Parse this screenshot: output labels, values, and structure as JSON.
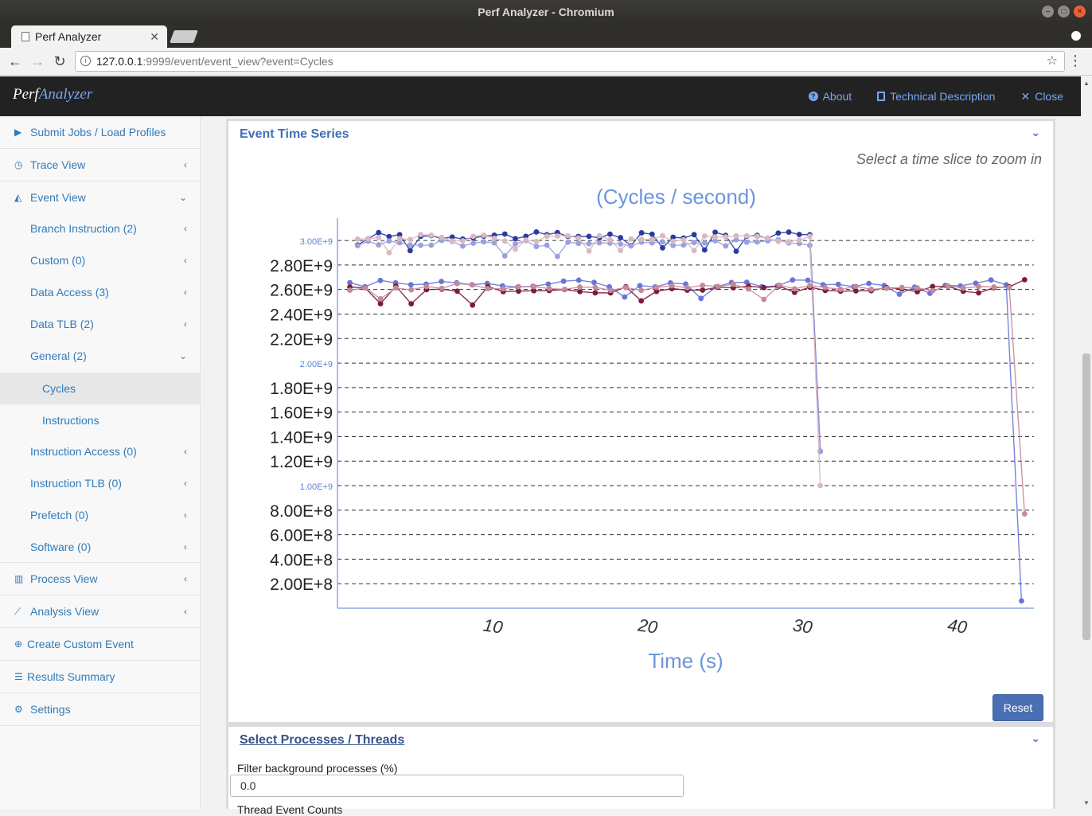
{
  "window": {
    "title": "Perf Analyzer - Chromium"
  },
  "browser": {
    "tab_title": "Perf Analyzer",
    "url_host": "127.0.0.1",
    "url_rest": ":9999/event/event_view?event=Cycles"
  },
  "header": {
    "brand_part1": "Perf",
    "brand_part2": "Analyzer",
    "links": {
      "about": "About",
      "technical": "Technical Description",
      "close": "Close"
    }
  },
  "sidebar": {
    "items": {
      "submit": "Submit Jobs / Load Profiles",
      "trace": "Trace View",
      "event": "Event View",
      "branch": "Branch Instruction (2)",
      "custom": "Custom (0)",
      "data_access": "Data Access (3)",
      "data_tlb": "Data TLB (2)",
      "general": "General (2)",
      "cycles": "Cycles",
      "instructions": "Instructions",
      "instr_access": "Instruction Access (0)",
      "instr_tlb": "Instruction TLB (0)",
      "prefetch": "Prefetch (0)",
      "software": "Software (0)",
      "process": "Process View",
      "analysis": "Analysis View",
      "create_custom": "Create Custom Event",
      "results": "Results Summary",
      "settings": "Settings"
    }
  },
  "event_panel": {
    "title": "Event Time Series",
    "hint": "Select a time slice to zoom in",
    "reset": "Reset"
  },
  "chart_data": {
    "type": "line",
    "title": "(Cycles / second)",
    "xlabel": "Time (s)",
    "ylabel": "",
    "xlim": [
      0,
      45
    ],
    "ylim": [
      0,
      3150000000
    ],
    "x_ticks": [
      "10",
      "20",
      "30",
      "40"
    ],
    "y_ticks_large": [
      "2.80E+9",
      "2.60E+9",
      "2.40E+9",
      "2.20E+9",
      "1.80E+9",
      "1.60E+9",
      "1.40E+9",
      "1.20E+9",
      "8.00E+8",
      "6.00E+8",
      "4.00E+8",
      "2.00E+8"
    ],
    "y_ticks_small": [
      "3.00E+9",
      "2.00E+9",
      "1.00E+9"
    ],
    "grid": true,
    "series": [
      {
        "color": "#2b3a9e",
        "start": 1.3,
        "end": 31.2,
        "level": 3040000000,
        "end_value": 1280000000
      },
      {
        "color": "#9aa0e0",
        "start": 1.3,
        "end": 31.2,
        "level": 2980000000,
        "end_value": 1280000000
      },
      {
        "color": "#d9b9c0",
        "start": 1.3,
        "end": 31.2,
        "level": 3020000000,
        "end_value": 1000000000
      },
      {
        "color": "#6a75d8",
        "start": 0.8,
        "end": 44.2,
        "level": 2650000000,
        "end_value": 60000000
      },
      {
        "color": "#7e1c34",
        "start": 0.8,
        "end": 44.4,
        "level": 2600000000,
        "end_value": 2680000000
      },
      {
        "color": "#c48a9a",
        "start": 0.8,
        "end": 44.4,
        "level": 2620000000,
        "end_value": 770000000
      }
    ]
  },
  "process_panel": {
    "title": "Select Processes / Threads",
    "filter_label": "Filter background processes (%)",
    "filter_value": "0.0",
    "thread_counts_label": "Thread Event Counts"
  }
}
